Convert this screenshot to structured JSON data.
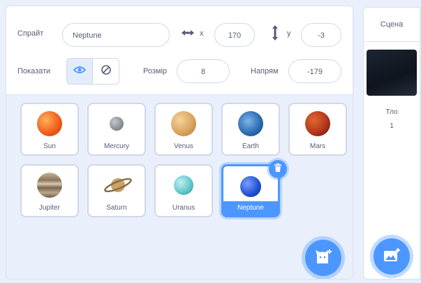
{
  "sprite_info": {
    "sprite_label": "Спрайт",
    "sprite_name": "Neptune",
    "x_label": "x",
    "x_value": "170",
    "y_label": "y",
    "y_value": "-3",
    "show_label": "Показати",
    "size_label": "Розмір",
    "size_value": "8",
    "direction_label": "Напрям",
    "direction_value": "-179"
  },
  "sprites": [
    {
      "name": "Sun",
      "color": "#f05a1a"
    },
    {
      "name": "Mercury",
      "color": "#8a8f96"
    },
    {
      "name": "Venus",
      "color": "#d9a05a"
    },
    {
      "name": "Earth",
      "color": "#2e6fb5"
    },
    {
      "name": "Mars",
      "color": "#b5361c"
    },
    {
      "name": "Jupiter",
      "color": "#8a7560"
    },
    {
      "name": "Saturn",
      "color": "#c8a46a"
    },
    {
      "name": "Uranus",
      "color": "#5ec4c8"
    },
    {
      "name": "Neptune",
      "color": "#1f4fd1",
      "selected": true
    }
  ],
  "stage": {
    "title": "Сцена",
    "backdrops_label": "Тло",
    "backdrops_count": "1"
  },
  "icons": {
    "show_visible": "eye-icon",
    "show_hidden": "eye-slash-icon",
    "x_arrow": "horizontal-arrows-icon",
    "y_arrow": "vertical-arrows-icon",
    "delete": "trash-icon",
    "choose_sprite": "cat-add-icon",
    "choose_backdrop": "backdrop-add-icon"
  },
  "colors": {
    "accent": "#4c97ff",
    "panel_bg": "#e9f0fb",
    "text": "#575e75"
  }
}
